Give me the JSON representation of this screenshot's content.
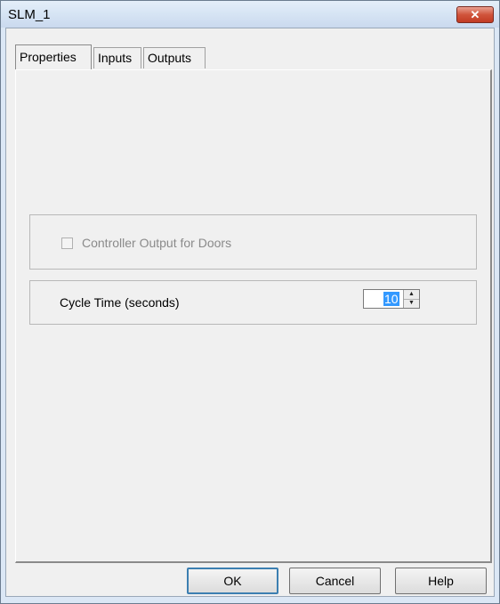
{
  "window": {
    "title": "SLM_1",
    "close_glyph": "✕"
  },
  "tabs": [
    {
      "label": "Properties",
      "active": true
    },
    {
      "label": "Inputs",
      "active": false
    },
    {
      "label": "Outputs",
      "active": false
    }
  ],
  "properties": {
    "doors_checkbox_label": "Controller Output for Doors",
    "doors_checkbox_checked": false,
    "doors_checkbox_enabled": false,
    "cycle_time_label": "Cycle Time (seconds)",
    "cycle_time_value": "10",
    "spin_up_glyph": "▲",
    "spin_down_glyph": "▼"
  },
  "buttons": {
    "ok": "OK",
    "cancel": "Cancel",
    "help": "Help"
  },
  "colors": {
    "selection": "#3399ff",
    "close_button": "#c23a22"
  }
}
